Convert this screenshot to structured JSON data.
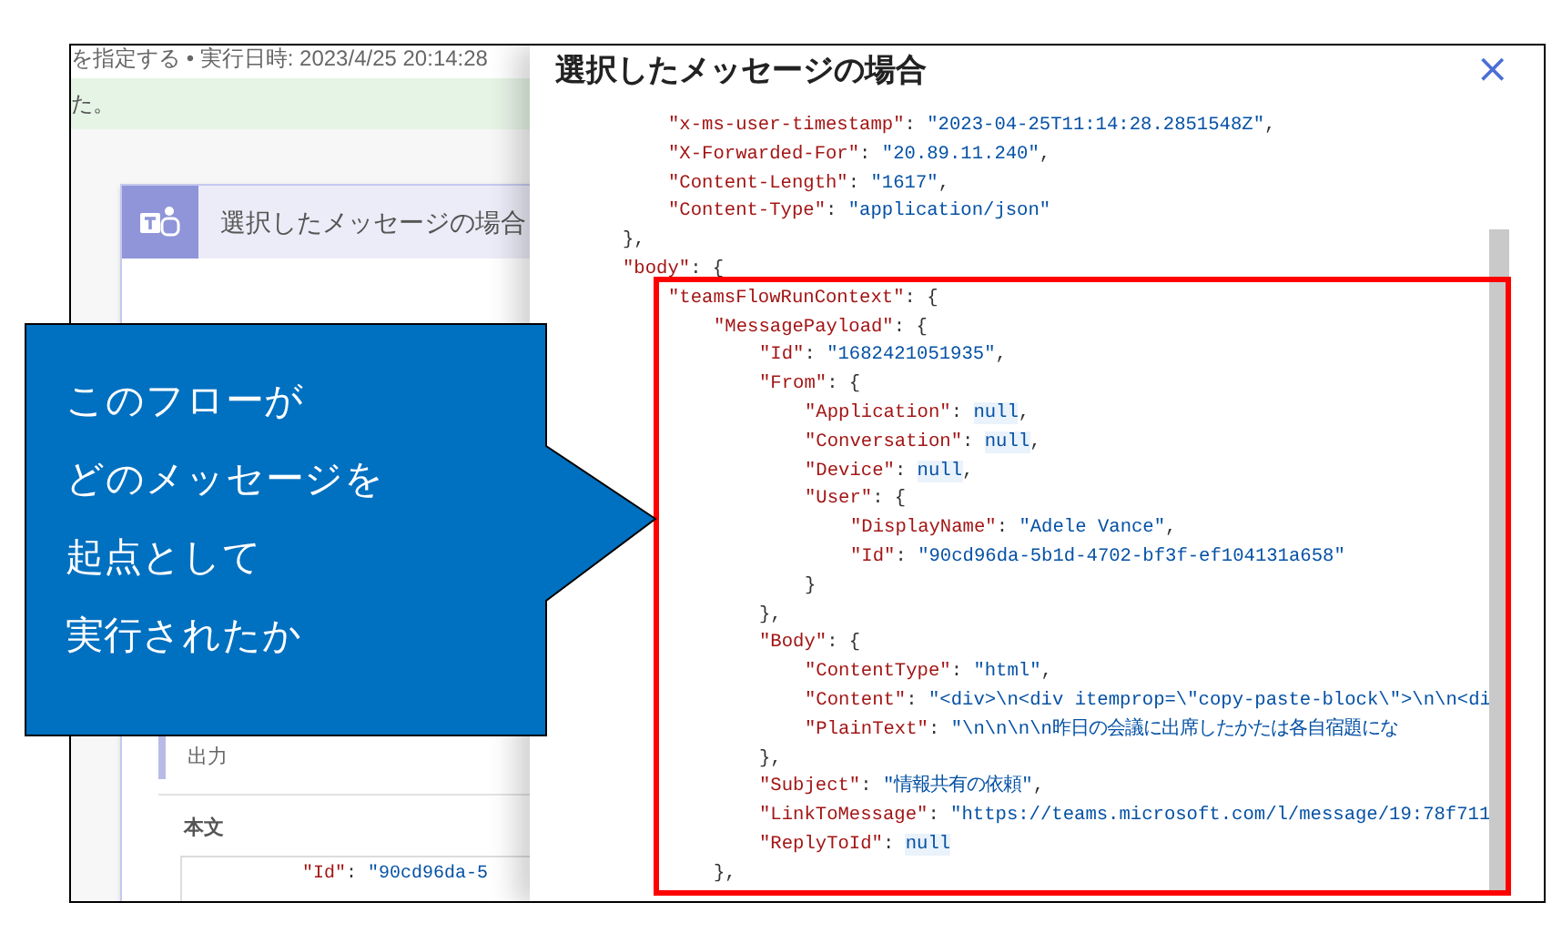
{
  "background_page": {
    "run_info": "を指定する • 実行日時: 2023/4/25 20:14:28",
    "banner": "た。",
    "card": {
      "title": "選択したメッセージの場合",
      "output_label": "出力",
      "body_label": "本文",
      "code_line": [
        {
          "kind": "key",
          "text": "\"Id\""
        },
        {
          "kind": "punct",
          "text": ": "
        },
        {
          "kind": "string",
          "text": "\"90cd96da-5"
        }
      ]
    }
  },
  "panel": {
    "title": "選択したメッセージの場合",
    "close": "×",
    "code": [
      {
        "children": [
          {
            "parts": [
              {
                "kind": "key",
                "text": "\"x-ms-user-timestamp\""
              },
              {
                "kind": "punct",
                "text": ": "
              },
              {
                "kind": "string",
                "text": "\"2023-04-25T11:14:28.2851548Z\""
              },
              {
                "kind": "punct",
                "text": ","
              }
            ]
          },
          {
            "parts": [
              {
                "kind": "key",
                "text": "\"X-Forwarded-For\""
              },
              {
                "kind": "punct",
                "text": ": "
              },
              {
                "kind": "string",
                "text": "\"20.89.11.240\""
              },
              {
                "kind": "punct",
                "text": ","
              }
            ]
          },
          {
            "parts": [
              {
                "kind": "key",
                "text": "\"Content-Length\""
              },
              {
                "kind": "punct",
                "text": ": "
              },
              {
                "kind": "string",
                "text": "\"1617\""
              },
              {
                "kind": "punct",
                "text": ","
              }
            ]
          },
          {
            "parts": [
              {
                "kind": "key",
                "text": "\"Content-Type\""
              },
              {
                "kind": "punct",
                "text": ": "
              },
              {
                "kind": "string",
                "text": "\"application/json\""
              }
            ]
          }
        ]
      },
      {
        "parts": [
          {
            "kind": "punct",
            "text": "},"
          }
        ]
      },
      {
        "parts": [
          {
            "kind": "key",
            "text": "\"body\""
          },
          {
            "kind": "punct",
            "text": ": {"
          }
        ],
        "children": [
          {
            "parts": [
              {
                "kind": "key",
                "text": "\"teamsFlowRunContext\""
              },
              {
                "kind": "punct",
                "text": ": {"
              }
            ],
            "children": [
              {
                "parts": [
                  {
                    "kind": "key",
                    "text": "\"MessagePayload\""
                  },
                  {
                    "kind": "punct",
                    "text": ": {"
                  }
                ],
                "children": [
                  {
                    "parts": [
                      {
                        "kind": "key",
                        "text": "\"Id\""
                      },
                      {
                        "kind": "punct",
                        "text": ": "
                      },
                      {
                        "kind": "string",
                        "text": "\"1682421051935\""
                      },
                      {
                        "kind": "punct",
                        "text": ","
                      }
                    ]
                  },
                  {
                    "parts": [
                      {
                        "kind": "key",
                        "text": "\"From\""
                      },
                      {
                        "kind": "punct",
                        "text": ": {"
                      }
                    ],
                    "children": [
                      {
                        "parts": [
                          {
                            "kind": "key",
                            "text": "\"Application\""
                          },
                          {
                            "kind": "punct",
                            "text": ": "
                          },
                          {
                            "kind": "null",
                            "text": "null"
                          },
                          {
                            "kind": "punct",
                            "text": ","
                          }
                        ]
                      },
                      {
                        "parts": [
                          {
                            "kind": "key",
                            "text": "\"Conversation\""
                          },
                          {
                            "kind": "punct",
                            "text": ": "
                          },
                          {
                            "kind": "null",
                            "text": "null"
                          },
                          {
                            "kind": "punct",
                            "text": ","
                          }
                        ]
                      },
                      {
                        "parts": [
                          {
                            "kind": "key",
                            "text": "\"Device\""
                          },
                          {
                            "kind": "punct",
                            "text": ": "
                          },
                          {
                            "kind": "null",
                            "text": "null"
                          },
                          {
                            "kind": "punct",
                            "text": ","
                          }
                        ]
                      },
                      {
                        "parts": [
                          {
                            "kind": "key",
                            "text": "\"User\""
                          },
                          {
                            "kind": "punct",
                            "text": ": {"
                          }
                        ],
                        "children": [
                          {
                            "parts": [
                              {
                                "kind": "key",
                                "text": "\"DisplayName\""
                              },
                              {
                                "kind": "punct",
                                "text": ": "
                              },
                              {
                                "kind": "string",
                                "text": "\"Adele Vance\""
                              },
                              {
                                "kind": "punct",
                                "text": ","
                              }
                            ]
                          },
                          {
                            "parts": [
                              {
                                "kind": "key",
                                "text": "\"Id\""
                              },
                              {
                                "kind": "punct",
                                "text": ": "
                              },
                              {
                                "kind": "string",
                                "text": "\"90cd96da-5b1d-4702-bf3f-ef104131a658\""
                              }
                            ]
                          }
                        ]
                      },
                      {
                        "parts": [
                          {
                            "kind": "punct",
                            "text": "}"
                          }
                        ]
                      }
                    ]
                  },
                  {
                    "parts": [
                      {
                        "kind": "punct",
                        "text": "},"
                      }
                    ]
                  },
                  {
                    "parts": [
                      {
                        "kind": "key",
                        "text": "\"Body\""
                      },
                      {
                        "kind": "punct",
                        "text": ": {"
                      }
                    ],
                    "children": [
                      {
                        "parts": [
                          {
                            "kind": "key",
                            "text": "\"ContentType\""
                          },
                          {
                            "kind": "punct",
                            "text": ": "
                          },
                          {
                            "kind": "string",
                            "text": "\"html\""
                          },
                          {
                            "kind": "punct",
                            "text": ","
                          }
                        ]
                      },
                      {
                        "parts": [
                          {
                            "kind": "key",
                            "text": "\"Content\""
                          },
                          {
                            "kind": "punct",
                            "text": ": "
                          },
                          {
                            "kind": "string",
                            "text": "\"<div>\\n<div itemprop=\\\"copy-paste-block\\\">\\n\\n<di"
                          }
                        ]
                      },
                      {
                        "parts": [
                          {
                            "kind": "key",
                            "text": "\"PlainText\""
                          },
                          {
                            "kind": "punct",
                            "text": ": "
                          },
                          {
                            "kind": "string",
                            "text": "\"\\n\\n\\n\\n昨日の会議に出席したかたは各自宿題にな"
                          }
                        ]
                      }
                    ]
                  },
                  {
                    "parts": [
                      {
                        "kind": "punct",
                        "text": "},"
                      }
                    ]
                  },
                  {
                    "parts": [
                      {
                        "kind": "key",
                        "text": "\"Subject\""
                      },
                      {
                        "kind": "punct",
                        "text": ": "
                      },
                      {
                        "kind": "string",
                        "text": "\"情報共有の依頼\""
                      },
                      {
                        "kind": "punct",
                        "text": ","
                      }
                    ]
                  },
                  {
                    "parts": [
                      {
                        "kind": "key",
                        "text": "\"LinkToMessage\""
                      },
                      {
                        "kind": "punct",
                        "text": ": "
                      },
                      {
                        "kind": "string",
                        "text": "\"https://teams.microsoft.com/l/message/19:78f711"
                      }
                    ]
                  },
                  {
                    "parts": [
                      {
                        "kind": "key",
                        "text": "\"ReplyToId\""
                      },
                      {
                        "kind": "punct",
                        "text": ": "
                      },
                      {
                        "kind": "null",
                        "text": "null"
                      }
                    ]
                  }
                ]
              },
              {
                "parts": [
                  {
                    "kind": "punct",
                    "text": "},"
                  }
                ]
              }
            ]
          }
        ]
      }
    ]
  },
  "callout": {
    "lines": [
      "このフローが",
      "どのメッセージを",
      "起点として",
      "実行されたか"
    ]
  }
}
